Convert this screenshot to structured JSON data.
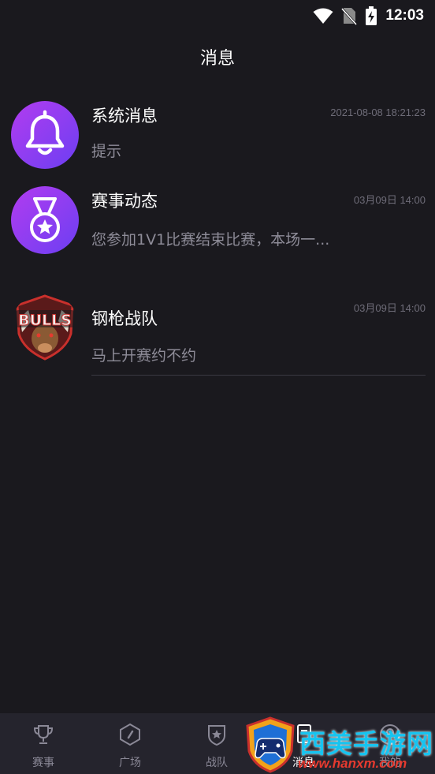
{
  "status_bar": {
    "time": "12:03",
    "icons": [
      "wifi-icon",
      "no-sim-icon",
      "battery-charging-icon"
    ]
  },
  "header": {
    "title": "消息"
  },
  "messages": [
    {
      "name": "系统消息",
      "time": "2021-08-08 18:21:23",
      "preview": "提示",
      "avatar": "bell-icon",
      "avatar_colors": [
        "#b23cf0",
        "#6c3ff2"
      ]
    },
    {
      "name": "赛事动态",
      "time": "03月09日 14:00",
      "preview": "您参加1V1比赛结束比赛，本场一...",
      "avatar": "medal-icon",
      "avatar_colors": [
        "#b23cf0",
        "#6c3ff2"
      ]
    },
    {
      "name": "钢枪战队",
      "time": "03月09日 14:00",
      "preview": "马上开赛约不约",
      "avatar": "bulls-team-logo",
      "avatar_text": "BULLS"
    }
  ],
  "tab_bar": {
    "tabs": [
      {
        "label": "赛事",
        "icon": "trophy-icon",
        "active": false
      },
      {
        "label": "广场",
        "icon": "compass-icon",
        "active": false
      },
      {
        "label": "战队",
        "icon": "team-shield-icon",
        "active": false
      },
      {
        "label": "消息",
        "icon": "message-icon",
        "active": true
      },
      {
        "label": "我的",
        "icon": "profile-icon",
        "active": false
      }
    ]
  },
  "watermark": {
    "text": "西美手游网",
    "url": "www.hanxm.com"
  },
  "colors": {
    "background": "#1a191e",
    "tab_bar": "#25242d",
    "avatar_gradient_start": "#b23cf0",
    "avatar_gradient_end": "#6c3ff2",
    "muted_text": "#8e8c98",
    "watermark_blue": "#17c4f0",
    "watermark_red": "#e63a2f"
  }
}
